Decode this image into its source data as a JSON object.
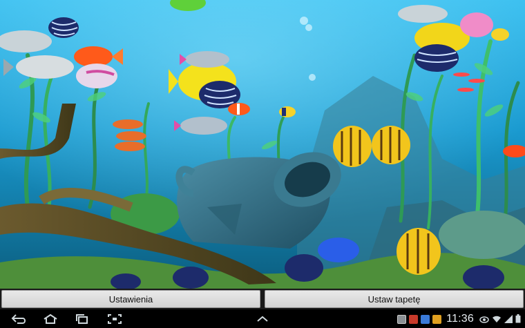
{
  "wallpaper": {
    "name": "aquarium-live-wallpaper",
    "colors": {
      "water_top": "#2aa6e0",
      "water_bottom": "#0a6a8c",
      "sand": "#6aa13a"
    }
  },
  "actions": {
    "settings_label": "Ustawienia",
    "set_wallpaper_label": "Ustaw tapetę"
  },
  "navigation": {
    "back_icon": "back-icon",
    "home_icon": "home-icon",
    "recent_apps_icon": "recent-apps-icon",
    "screenshot_icon": "screenshot-icon",
    "up_icon": "chevron-up-icon"
  },
  "status": {
    "time": "11:36",
    "icons": [
      "gallery-notification-icon",
      "app-notification-icon",
      "app-notification-icon",
      "app-notification-icon",
      "eye-icon",
      "wifi-icon",
      "signal-icon",
      "battery-icon"
    ]
  }
}
